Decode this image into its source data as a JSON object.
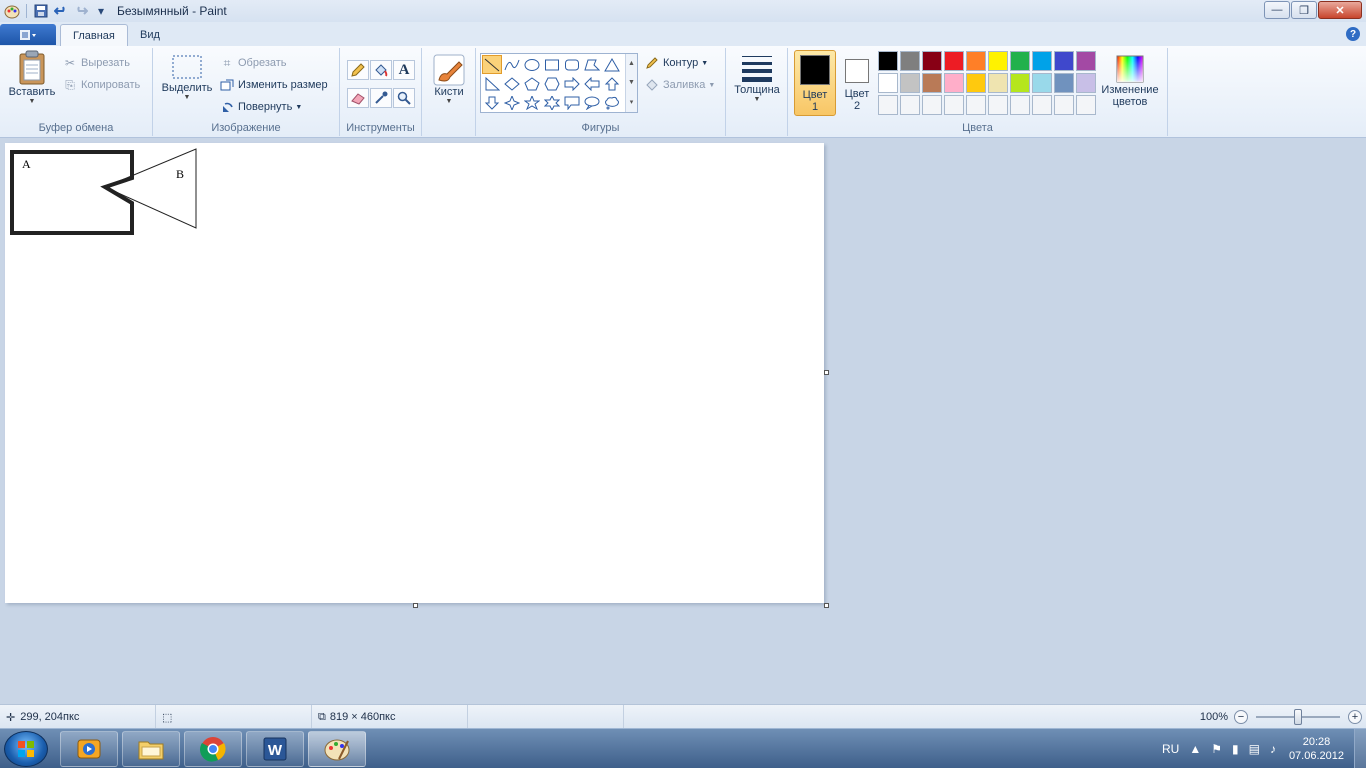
{
  "window": {
    "title": "Безымянный - Paint",
    "min_glyph": "—",
    "max_glyph": "❐",
    "close_glyph": "✕"
  },
  "tabs": [
    {
      "label": "Главная",
      "active": true
    },
    {
      "label": "Вид",
      "active": false
    }
  ],
  "help_glyph": "?",
  "clipboard": {
    "paste_label": "Вставить",
    "cut_label": "Вырезать",
    "copy_label": "Копировать",
    "group_label": "Буфер обмена"
  },
  "image": {
    "select_label": "Выделить",
    "crop_label": "Обрезать",
    "resize_label": "Изменить размер",
    "rotate_label": "Повернуть",
    "group_label": "Изображение"
  },
  "tools": {
    "group_label": "Инструменты",
    "text_glyph": "A"
  },
  "brushes": {
    "label": "Кисти"
  },
  "shapes": {
    "group_label": "Фигуры",
    "outline_label": "Контур",
    "fill_label": "Заливка"
  },
  "size": {
    "label": "Толщина"
  },
  "colors": {
    "color1_label_line1": "Цвет",
    "color1_label_line2": "1",
    "color2_label_line1": "Цвет",
    "color2_label_line2": "2",
    "color1_value": "#000000",
    "color2_value": "#ffffff",
    "edit_label_line1": "Изменение",
    "edit_label_line2": "цветов",
    "group_label": "Цвета",
    "palette": [
      "#000000",
      "#7f7f7f",
      "#880015",
      "#ed1c24",
      "#ff7f27",
      "#fff200",
      "#22b14c",
      "#00a2e8",
      "#3f48cc",
      "#a349a4",
      "#ffffff",
      "#c3c3c3",
      "#b97a57",
      "#ffaec9",
      "#ffc90e",
      "#efe4b0",
      "#b5e61d",
      "#99d9ea",
      "#7092be",
      "#c8bfe7",
      "#f3f5f8",
      "#f3f5f8",
      "#f3f5f8",
      "#f3f5f8",
      "#f3f5f8",
      "#f3f5f8",
      "#f3f5f8",
      "#f3f5f8",
      "#f3f5f8",
      "#f3f5f8"
    ]
  },
  "drawing": {
    "label_a": "A",
    "label_b": "B"
  },
  "status": {
    "cursor_pos": "299, 204пкс",
    "selection_size": "",
    "image_size": "819 × 460пкс",
    "zoom": "100%"
  },
  "tray": {
    "lang": "RU",
    "time": "20:28",
    "date": "07.06.2012"
  }
}
